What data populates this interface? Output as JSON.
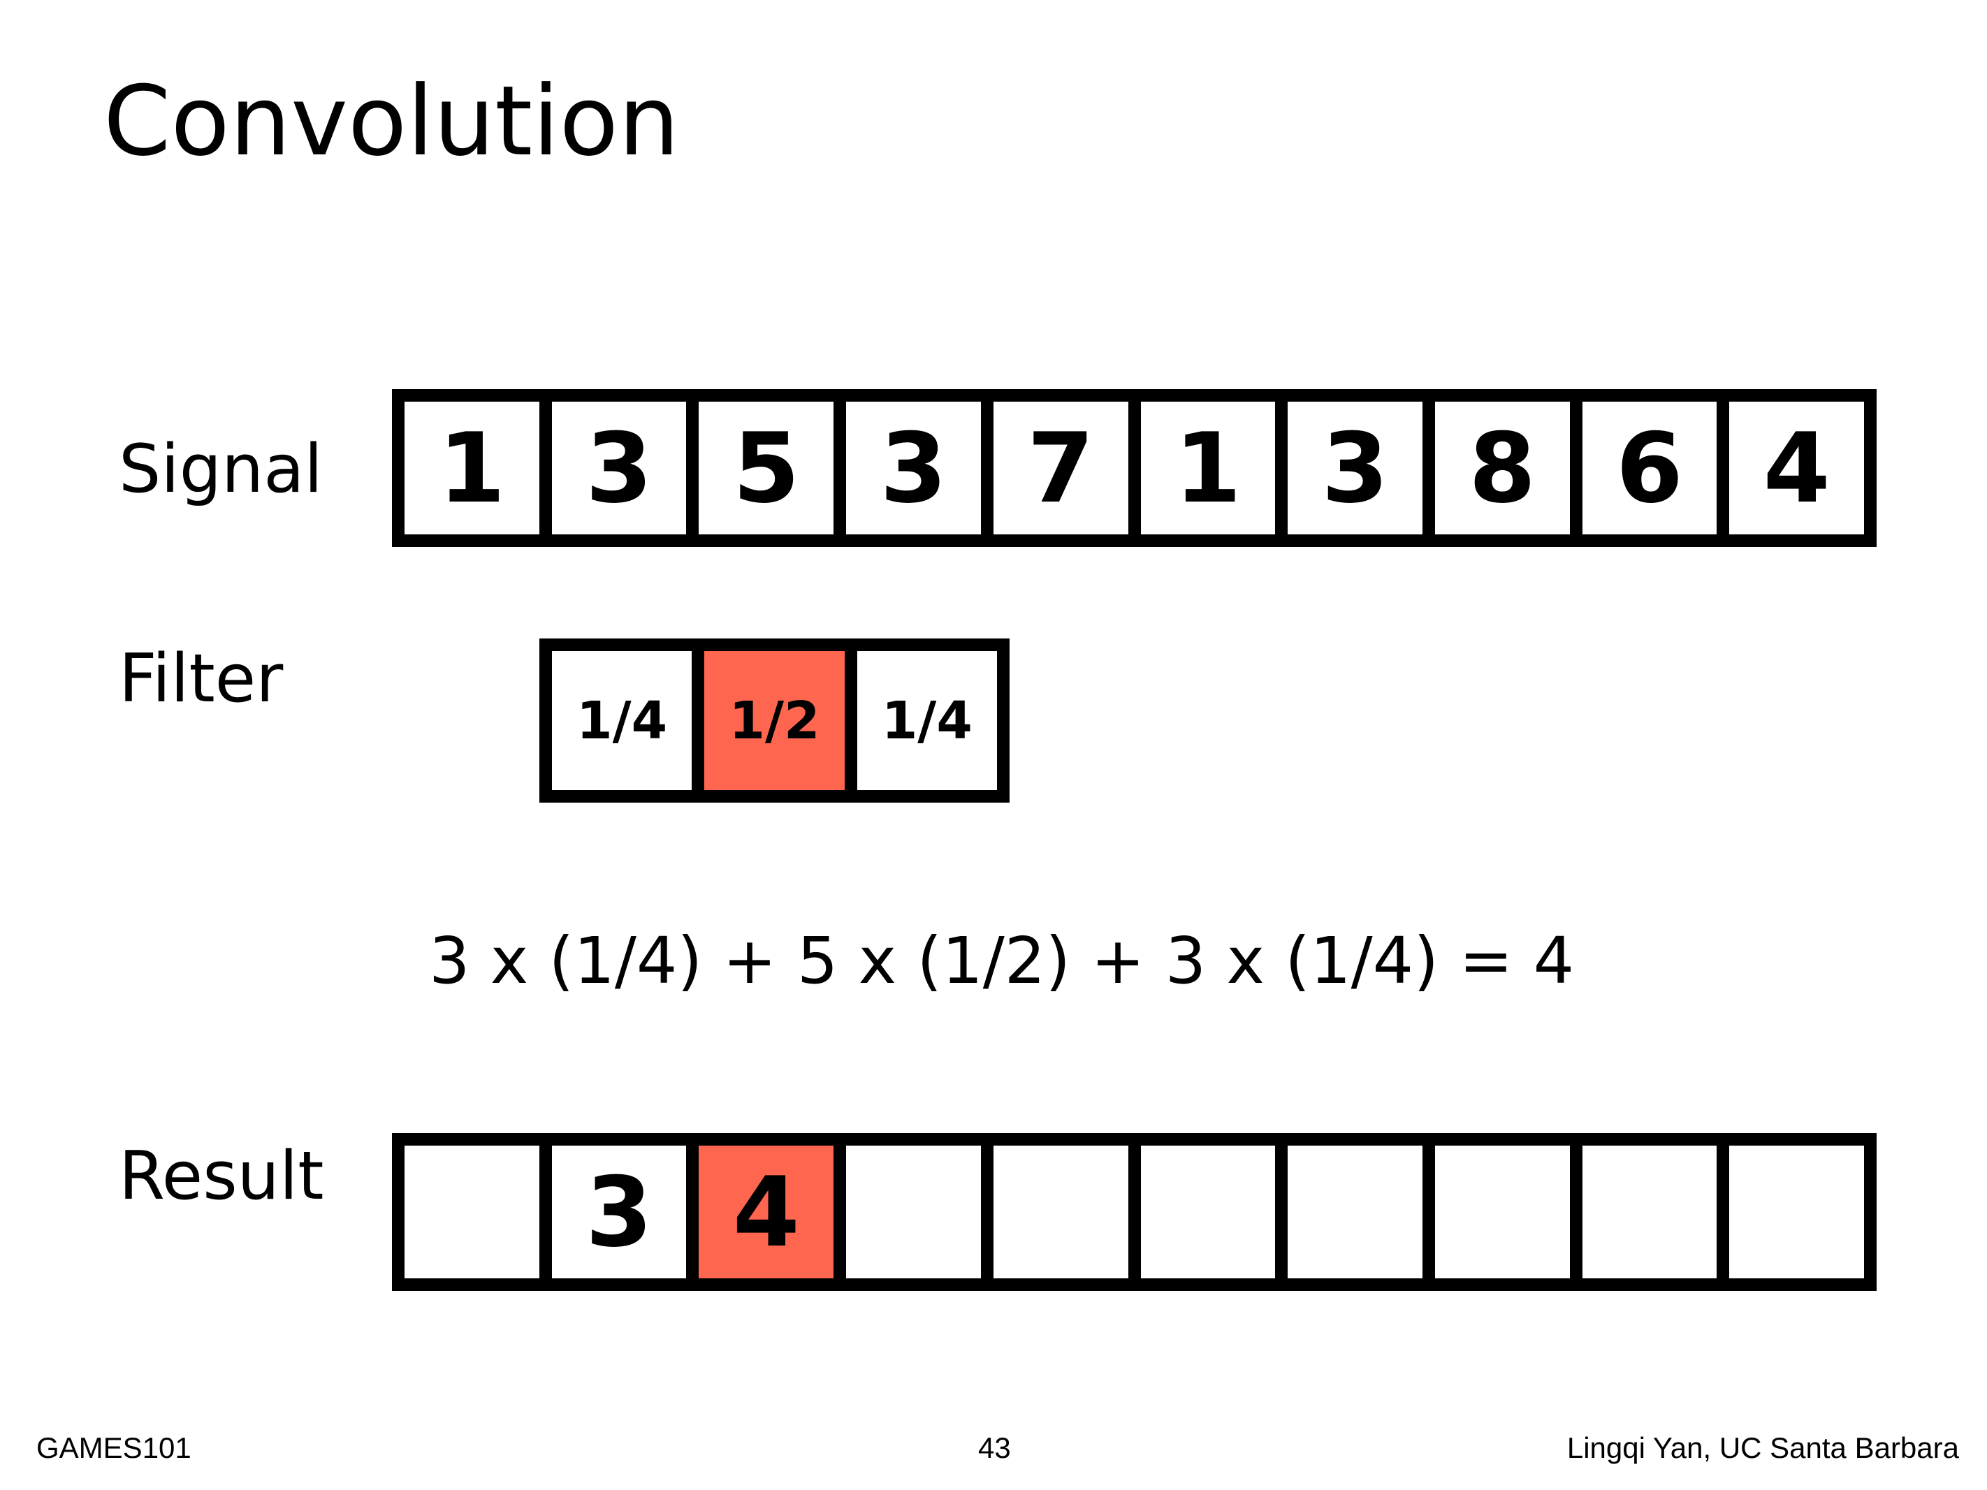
{
  "slide": {
    "title": "Convolution",
    "signal_label": "Signal",
    "filter_label": "Filter",
    "result_label": "Result",
    "formula": "3 x (1/4) + 5 x (1/2) + 3 x (1/4) = 4",
    "highlight_color": "#ff6650"
  },
  "signal": [
    "1",
    "3",
    "5",
    "3",
    "7",
    "1",
    "3",
    "8",
    "6",
    "4"
  ],
  "filter": [
    "1/4",
    "1/2",
    "1/4"
  ],
  "filter_highlight_index": 1,
  "result": [
    "",
    "3",
    "4",
    "",
    "",
    "",
    "",
    "",
    "",
    ""
  ],
  "result_highlight_index": 2,
  "footer": {
    "left": "GAMES101",
    "page_number": "43",
    "right": "Lingqi Yan, UC Santa Barbara"
  }
}
